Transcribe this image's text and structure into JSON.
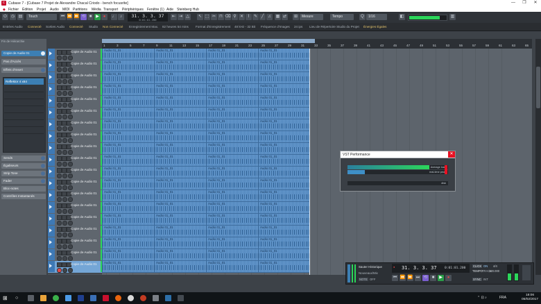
{
  "window": {
    "title": "Cubase 7 - [Cubase 7 Projet de Alexandre Chacal Criodo - bench focusrite]",
    "controls": [
      "—",
      "❐",
      "✕"
    ]
  },
  "menu": [
    "Fichier",
    "Édition",
    "Projet",
    "Audio",
    "MIDI",
    "Partitions",
    "Média",
    "Transport",
    "Périphériques",
    "Fenêtre (1)",
    "Aide",
    "Steinberg Hub"
  ],
  "toolbar": {
    "touch_mode": "Touch",
    "counter_main": "31. 3. 3. 37",
    "counter_sub": "0:01:01.200",
    "snap": "Mesure",
    "quantize": "Tempo",
    "grid_value": "1/16"
  },
  "status": {
    "audio_inputs": "Entrées Audio",
    "audio_inputs_state": "Connecté",
    "audio_outputs": "Sorties Audio",
    "audio_outputs_state": "Connecté",
    "studio": "Studio",
    "studio_state": "Non Connecté",
    "record_time": "Enregistrement Max.",
    "record_time_value": "82 heures 54 mins",
    "record_format": "Format d'Enregistrement",
    "record_format_value": "48 kHz - 32 Bit",
    "frame_rate": "Fréquence d'Images",
    "frame_rate_value": "24 ips",
    "project_folder": "Lieu de Répertoire Studio du Projet",
    "project_folder_value": "Énergies Égales"
  },
  "inspector": {
    "header": "Fin de Hiérarchie",
    "track_name": "Copie de Audio 01",
    "routing_in": "Pas d'Accès",
    "routing_out": "Master",
    "insert_label": "Effets d'Insert",
    "plugin": "Reflektor 4 x64",
    "sections": [
      "Sends",
      "Égaliseurs",
      "Strip Tone",
      "Fader",
      "Bloc-notes",
      "Contrôles Instantanés"
    ]
  },
  "tracks": {
    "name": "Copie de Audio 01",
    "count": 19
  },
  "events": {
    "clip_name": "Audio 01_01"
  },
  "ruler": {
    "bars": [
      "1",
      "3",
      "5",
      "7",
      "9",
      "11",
      "13",
      "15",
      "17",
      "19",
      "21",
      "23",
      "25",
      "27",
      "29",
      "31",
      "33",
      "35",
      "37",
      "39",
      "41",
      "43",
      "45",
      "47",
      "49",
      "51",
      "53",
      "55",
      "57",
      "59",
      "61",
      "63",
      "65"
    ]
  },
  "vst_performance": {
    "title": "VST Performance",
    "average_load_label": "Average load",
    "average_load": 0.85,
    "realtime_peak_label": "real-time peak",
    "realtime_peak": 0.18,
    "disk_label": "disk",
    "disk_load": 0.0
  },
  "transport": {
    "marker_label": "Sauter Historique",
    "marker_sub": "Nouveaux/Mix",
    "mode_a": "NOTE",
    "mode_b": "OFF",
    "position": "31. 3. 3. 37",
    "time": "0:01:01.200",
    "click": "CLICK",
    "click_state": "ON",
    "tempo_label": "TEMPO",
    "tempo_state": "TRACK",
    "signature": "4/4",
    "tempo": "120.000",
    "sync": "SYNC",
    "sync_state": "INT"
  },
  "taskbar": {
    "language": "FRA",
    "time": "18:06",
    "date": "05/02/2017"
  },
  "colors": {
    "accent": "#3c7fb4",
    "event": "#6b9dd0",
    "load_green": "#2bd65a",
    "close_red": "#e81123"
  }
}
